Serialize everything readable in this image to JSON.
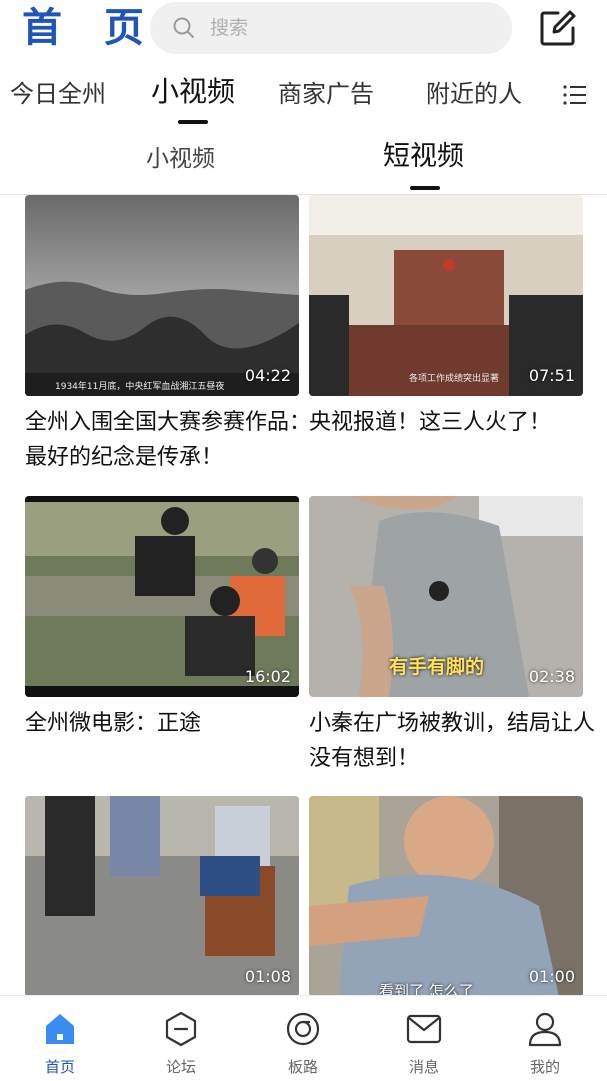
{
  "header": {
    "title": "首 页",
    "search_placeholder": "搜索"
  },
  "channel_tabs": [
    {
      "label": "今日全州"
    },
    {
      "label": "小视频",
      "active": true
    },
    {
      "label": "商家广告"
    },
    {
      "label": "附近的人"
    }
  ],
  "sub_tabs": [
    {
      "label": "小视频"
    },
    {
      "label": "短视频",
      "active": true
    }
  ],
  "videos": [
    {
      "title": "全州入围全国大赛参赛作品：最好的纪念是传承！",
      "duration": "04:22",
      "subtitle": "1934年11月底，中央红军血战湘江五昼夜"
    },
    {
      "title": "央视报道！这三人火了！",
      "duration": "07:51",
      "subtitle": "各项工作成绩突出显著"
    },
    {
      "title": "全州微电影：正途",
      "duration": "16:02"
    },
    {
      "title": "小秦在广场被教训，结局让人没有想到！",
      "duration": "02:38",
      "subtitle": "有手有脚的"
    },
    {
      "title": "",
      "duration": "01:08"
    },
    {
      "title": "",
      "duration": "01:00",
      "subtitle": "看到了 怎么了"
    }
  ],
  "bottom_nav": [
    {
      "label": "首页",
      "icon": "home-icon",
      "active": true
    },
    {
      "label": "论坛",
      "icon": "forum-icon"
    },
    {
      "label": "板路",
      "icon": "banlu-icon"
    },
    {
      "label": "消息",
      "icon": "message-icon"
    },
    {
      "label": "我的",
      "icon": "profile-icon"
    }
  ],
  "colors": {
    "brand": "#1f55b8",
    "text": "#111111",
    "muted": "#666666"
  }
}
